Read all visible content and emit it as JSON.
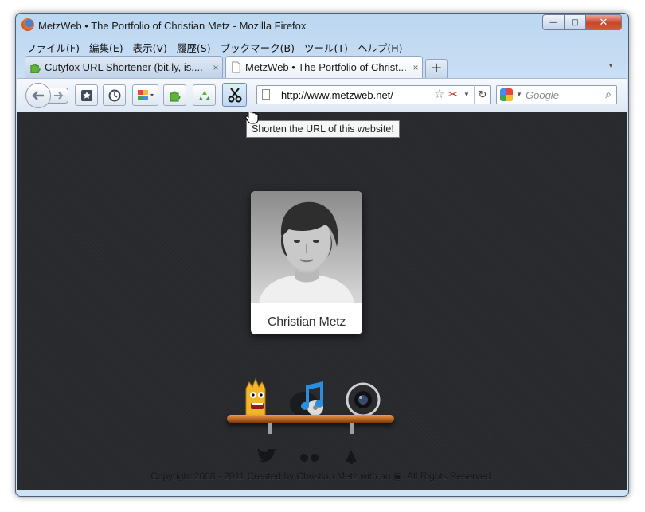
{
  "window": {
    "title": "MetzWeb • The Portfolio of Christian Metz - Mozilla Firefox",
    "controls": {
      "minimize": "—",
      "maximize": "□",
      "close": "✕"
    }
  },
  "menubar": {
    "items": [
      {
        "label": "ファイル(F)"
      },
      {
        "label": "編集(E)"
      },
      {
        "label": "表示(V)"
      },
      {
        "label": "履歴(S)"
      },
      {
        "label": "ブックマーク(B)"
      },
      {
        "label": "ツール(T)"
      },
      {
        "label": "ヘルプ(H)"
      }
    ]
  },
  "tabs": [
    {
      "label": "Cutyfox URL Shortener (bit.ly, is....",
      "close": "×",
      "active": false
    },
    {
      "label": "MetzWeb • The Portfolio of Christ...",
      "close": "×",
      "active": true
    }
  ],
  "new_tab": "+",
  "tab_list_arrow": "▾",
  "toolbar": {
    "url": "http://www.metzweb.net/",
    "search_placeholder": "Google",
    "tooltip": "Shorten the URL of this website!"
  },
  "page": {
    "name": "Christian Metz",
    "footer": "Copyright 2008 - 2011 Created by Christian Metz with an ▣. All Rights Reserved."
  },
  "colors": {
    "page_background": "#27292d",
    "shelf": "#c5732c",
    "accent_blue": "#2a8de0"
  }
}
